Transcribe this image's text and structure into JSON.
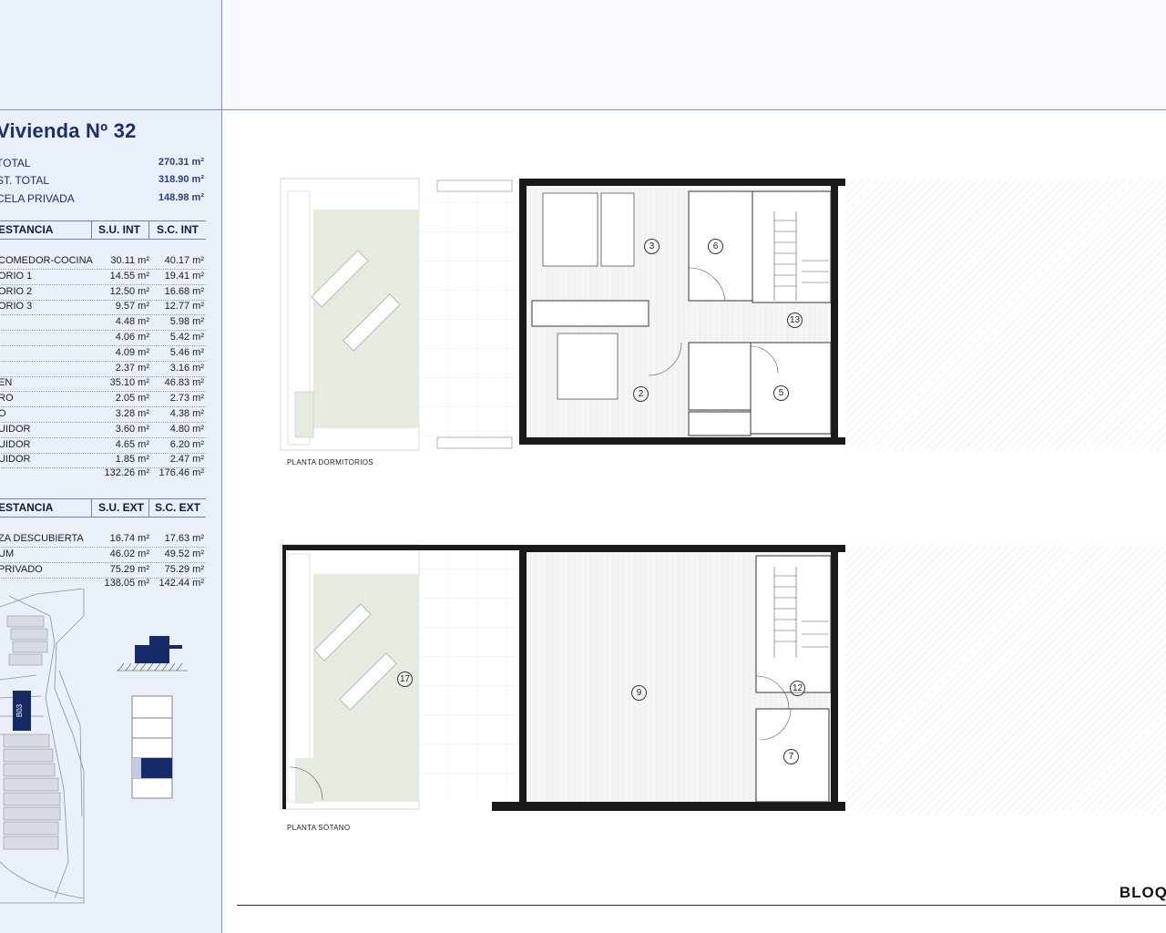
{
  "unit_title": "Vivienda Nº 32",
  "summary": [
    {
      "label": "TOTAL",
      "value": "270.31 m²"
    },
    {
      "label": "ST. TOTAL",
      "value": "318.90 m²"
    },
    {
      "label": "CELA PRIVADA",
      "value": "148.98 m²"
    }
  ],
  "interior": {
    "headers": [
      "ESTANCIA",
      "S.U. INT",
      "S.C. INT"
    ],
    "rows": [
      [
        "COMEDOR-COCINA",
        "30.11 m²",
        "40.17 m²"
      ],
      [
        "ORIO 1",
        "14.55 m²",
        "19.41 m²"
      ],
      [
        "ORIO 2",
        "12.50 m²",
        "16.68 m²"
      ],
      [
        "ORIO 3",
        "9.57 m²",
        "12.77 m²"
      ],
      [
        "",
        "4.48 m²",
        "5.98 m²"
      ],
      [
        "",
        "4.06 m²",
        "5.42 m²"
      ],
      [
        "",
        "4.09 m²",
        "5.46 m²"
      ],
      [
        "",
        "2.37 m²",
        "3.16 m²"
      ],
      [
        "EN",
        "35.10 m²",
        "46.83 m²"
      ],
      [
        "RO",
        "2.05 m²",
        "2.73 m²"
      ],
      [
        "O",
        "3.28 m²",
        "4.38 m²"
      ],
      [
        "UIDOR",
        "3.60 m²",
        "4.80 m²"
      ],
      [
        "UIDOR",
        "4.65 m²",
        "6.20 m²"
      ],
      [
        "UIDOR",
        "1.85 m²",
        "2.47 m²"
      ]
    ],
    "total_su": "132.26 m²",
    "total_sc": "176.46 m²"
  },
  "exterior": {
    "headers": [
      "ESTANCIA",
      "S.U. EXT",
      "S.C. EXT"
    ],
    "rows": [
      [
        "ZA DESCUBIERTA",
        "16.74 m²",
        "17.63 m²"
      ],
      [
        "UM",
        "46.02 m²",
        "49.52 m²"
      ],
      [
        "PRIVADO",
        "75.29 m²",
        "75.29 m²"
      ]
    ],
    "total_su": "138.05 m²",
    "total_sc": "142.44 m²"
  },
  "site_block_label": "B03",
  "plans": {
    "upper_label": "PLANTA DORMITORIOS",
    "lower_label": "PLANTA SÓTANO"
  },
  "rooms_upper": [
    "3",
    "6",
    "13",
    "2",
    "5"
  ],
  "rooms_lower": [
    "17",
    "9",
    "12",
    "7"
  ],
  "block_label": "BLOQ",
  "colors": {
    "sidebar_bg": "#eaf0fa",
    "title_navy": "#1c2f6e",
    "grass": "#e6ede0",
    "floor_hatch": "#ededed",
    "wall": "#1a1a1a",
    "accent_block": "#152a66"
  }
}
